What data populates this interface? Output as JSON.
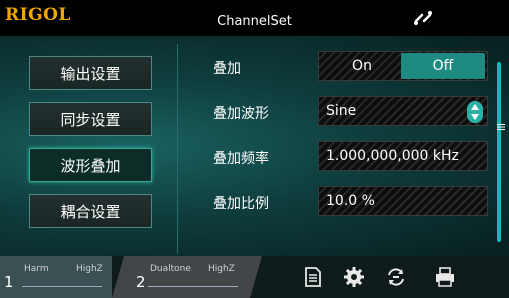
{
  "header": {
    "logo": "RIGOL",
    "title": "ChannelSet"
  },
  "menu": [
    {
      "label": "输出设置",
      "active": false
    },
    {
      "label": "同步设置",
      "active": false
    },
    {
      "label": "波形叠加",
      "active": true
    },
    {
      "label": "耦合设置",
      "active": false
    }
  ],
  "settings": {
    "overlay_label": "叠加",
    "toggle_on": "On",
    "toggle_off": "Off",
    "toggle_selected": "Off",
    "waveform_label": "叠加波形",
    "waveform_value": "Sine",
    "frequency_label": "叠加频率",
    "frequency_value": "1.000,000,000 kHz",
    "ratio_label": "叠加比例",
    "ratio_value": "10.0 %"
  },
  "channels": [
    {
      "number": "1",
      "mode": "Harm",
      "impedance": "HighZ"
    },
    {
      "number": "2",
      "mode": "Dualtone",
      "impedance": "HighZ"
    }
  ],
  "icons": [
    "network-icon",
    "file-icon",
    "gear-icon",
    "sync-icon",
    "printer-icon"
  ],
  "colors": {
    "accent": "#1e8a82",
    "brand": "#f2a600"
  }
}
